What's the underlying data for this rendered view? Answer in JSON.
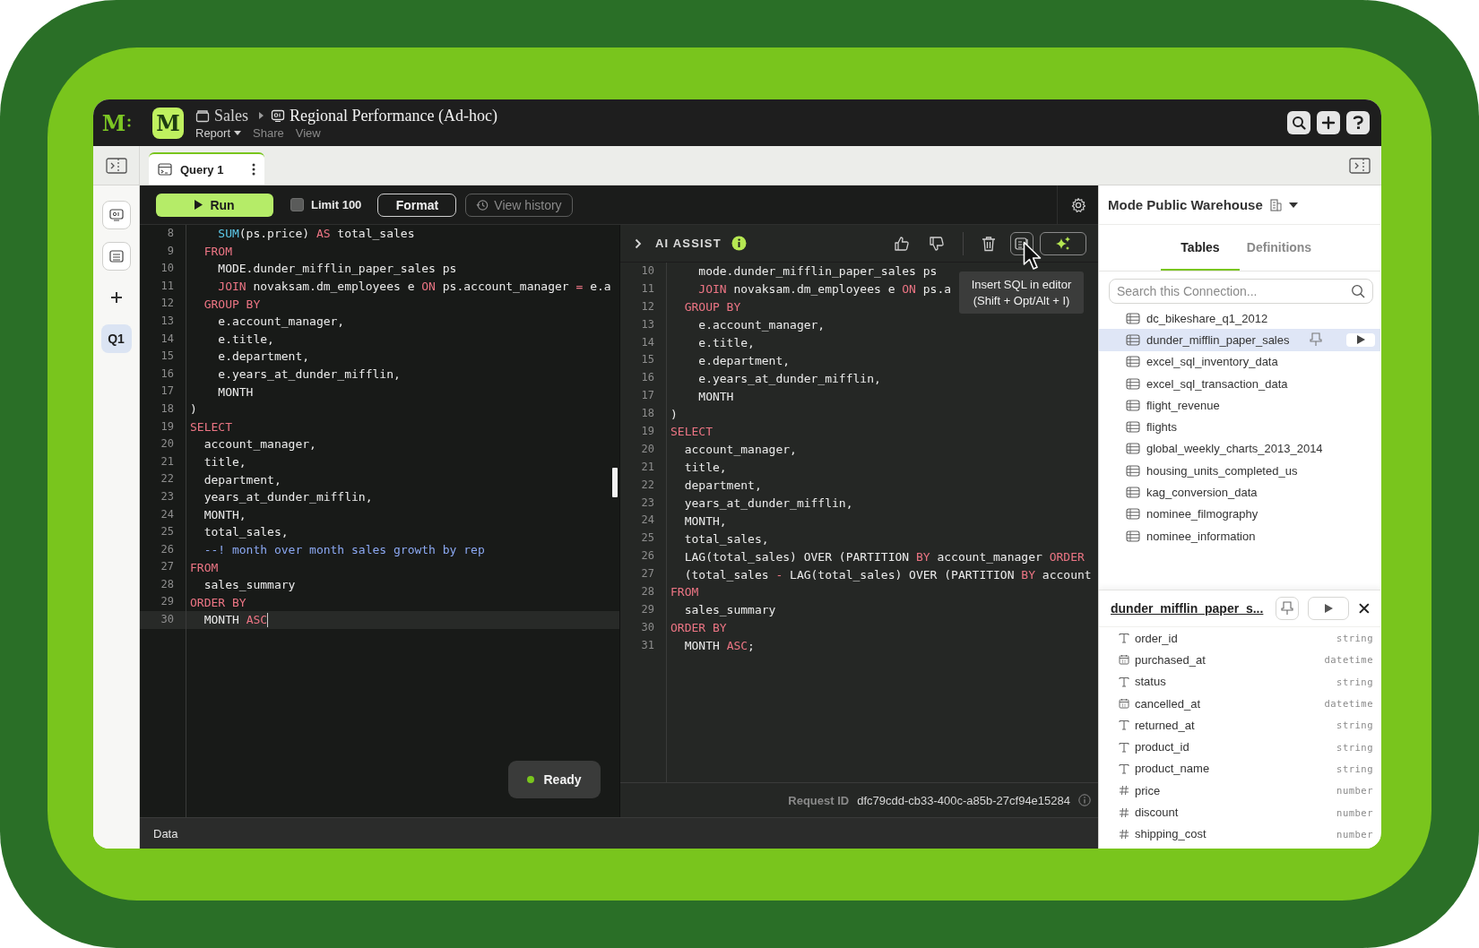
{
  "app": {
    "logo": "M",
    "workspace_logo": "M"
  },
  "breadcrumb": [
    {
      "label": "Sales",
      "kind": "folder"
    },
    {
      "label": "Regional Performance (Ad-hoc)",
      "kind": "report"
    }
  ],
  "report_menu": [
    {
      "label": "Report",
      "kind": "dropdown",
      "disabled": false
    },
    {
      "label": "Share",
      "kind": "link",
      "disabled": true
    },
    {
      "label": "View",
      "kind": "link",
      "disabled": true
    }
  ],
  "rail": {
    "badge": "Q1"
  },
  "tabs": [
    {
      "label": "Query 1",
      "selected": true
    }
  ],
  "toolbar": {
    "run": "Run",
    "limit": {
      "label": "Limit 100",
      "checked": false
    },
    "format": "Format",
    "history": {
      "label": "View history",
      "disabled": true
    }
  },
  "editor": {
    "lines": [
      {
        "number": "8",
        "current": false,
        "tokens": [
          {
            "text": "    SUM",
            "kind": "fn"
          },
          {
            "text": "(ps.price) ",
            "kind": "p"
          },
          {
            "text": "AS",
            "kind": "kw"
          },
          {
            "text": " total_sales",
            "kind": "p"
          }
        ]
      },
      {
        "number": "9",
        "current": false,
        "tokens": [
          {
            "text": "  FROM",
            "kind": "kw"
          }
        ]
      },
      {
        "number": "10",
        "current": false,
        "tokens": [
          {
            "text": "    MODE.dunder_mifflin_paper_sales ps",
            "kind": "p"
          }
        ]
      },
      {
        "number": "11",
        "current": false,
        "tokens": [
          {
            "text": "    JOIN",
            "kind": "kw"
          },
          {
            "text": " novaksam.dm_employees e ",
            "kind": "p"
          },
          {
            "text": "ON",
            "kind": "kw"
          },
          {
            "text": " ps.account_manager ",
            "kind": "p"
          },
          {
            "text": "=",
            "kind": "kw"
          },
          {
            "text": " e.a",
            "kind": "p"
          }
        ]
      },
      {
        "number": "12",
        "current": false,
        "tokens": [
          {
            "text": "  GROUP BY",
            "kind": "kw"
          }
        ]
      },
      {
        "number": "13",
        "current": false,
        "tokens": [
          {
            "text": "    e.account_manager,",
            "kind": "p"
          }
        ]
      },
      {
        "number": "14",
        "current": false,
        "tokens": [
          {
            "text": "    e.title,",
            "kind": "p"
          }
        ]
      },
      {
        "number": "15",
        "current": false,
        "tokens": [
          {
            "text": "    e.department,",
            "kind": "p"
          }
        ]
      },
      {
        "number": "16",
        "current": false,
        "tokens": [
          {
            "text": "    e.years_at_dunder_mifflin,",
            "kind": "p"
          }
        ]
      },
      {
        "number": "17",
        "current": false,
        "tokens": [
          {
            "text": "    MONTH",
            "kind": "p"
          }
        ]
      },
      {
        "number": "18",
        "current": false,
        "tokens": [
          {
            "text": ")",
            "kind": "p"
          }
        ]
      },
      {
        "number": "19",
        "current": false,
        "tokens": [
          {
            "text": "SELECT",
            "kind": "kw"
          }
        ]
      },
      {
        "number": "20",
        "current": false,
        "tokens": [
          {
            "text": "  account_manager,",
            "kind": "p"
          }
        ]
      },
      {
        "number": "21",
        "current": false,
        "tokens": [
          {
            "text": "  title,",
            "kind": "p"
          }
        ]
      },
      {
        "number": "22",
        "current": false,
        "tokens": [
          {
            "text": "  department,",
            "kind": "p"
          }
        ]
      },
      {
        "number": "23",
        "current": false,
        "tokens": [
          {
            "text": "  years_at_dunder_mifflin,",
            "kind": "p"
          }
        ]
      },
      {
        "number": "24",
        "current": false,
        "tokens": [
          {
            "text": "  MONTH,",
            "kind": "p"
          }
        ]
      },
      {
        "number": "25",
        "current": false,
        "tokens": [
          {
            "text": "  total_sales,",
            "kind": "p"
          }
        ]
      },
      {
        "number": "26",
        "current": false,
        "tokens": [
          {
            "text": "  --! month over month sales growth by rep",
            "kind": "cmt"
          }
        ]
      },
      {
        "number": "27",
        "current": false,
        "tokens": [
          {
            "text": "FROM",
            "kind": "kw"
          }
        ]
      },
      {
        "number": "28",
        "current": false,
        "tokens": [
          {
            "text": "  sales_summary",
            "kind": "p"
          }
        ]
      },
      {
        "number": "29",
        "current": false,
        "tokens": [
          {
            "text": "ORDER BY",
            "kind": "kw"
          }
        ]
      },
      {
        "number": "30",
        "current": true,
        "tokens": [
          {
            "text": "  MONTH ",
            "kind": "p"
          },
          {
            "text": "ASC",
            "kind": "kw"
          }
        ]
      }
    ],
    "status": "Ready"
  },
  "ai_assist": {
    "title": "AI ASSIST",
    "tooltip": {
      "title": "Insert SQL in editor",
      "shortcut": "(Shift + Opt/Alt + I)"
    },
    "lines": [
      {
        "number": "10",
        "tokens": [
          {
            "text": "    mode.dunder_mifflin_paper_sales ps",
            "kind": "p"
          }
        ]
      },
      {
        "number": "11",
        "tokens": [
          {
            "text": "    JOIN",
            "kind": "kw"
          },
          {
            "text": " novaksam.dm_employees e ",
            "kind": "p"
          },
          {
            "text": "ON",
            "kind": "kw"
          },
          {
            "text": " ps.a",
            "kind": "p"
          }
        ]
      },
      {
        "number": "12",
        "tokens": [
          {
            "text": "  GROUP BY",
            "kind": "kw"
          }
        ]
      },
      {
        "number": "13",
        "tokens": [
          {
            "text": "    e.account_manager,",
            "kind": "p"
          }
        ]
      },
      {
        "number": "14",
        "tokens": [
          {
            "text": "    e.title,",
            "kind": "p"
          }
        ]
      },
      {
        "number": "15",
        "tokens": [
          {
            "text": "    e.department,",
            "kind": "p"
          }
        ]
      },
      {
        "number": "16",
        "tokens": [
          {
            "text": "    e.years_at_dunder_mifflin,",
            "kind": "p"
          }
        ]
      },
      {
        "number": "17",
        "tokens": [
          {
            "text": "    MONTH",
            "kind": "p"
          }
        ]
      },
      {
        "number": "18",
        "tokens": [
          {
            "text": ")",
            "kind": "p"
          }
        ]
      },
      {
        "number": "19",
        "tokens": [
          {
            "text": "SELECT",
            "kind": "kw"
          }
        ]
      },
      {
        "number": "20",
        "tokens": [
          {
            "text": "  account_manager,",
            "kind": "p"
          }
        ]
      },
      {
        "number": "21",
        "tokens": [
          {
            "text": "  title,",
            "kind": "p"
          }
        ]
      },
      {
        "number": "22",
        "tokens": [
          {
            "text": "  department,",
            "kind": "p"
          }
        ]
      },
      {
        "number": "23",
        "tokens": [
          {
            "text": "  years_at_dunder_mifflin,",
            "kind": "p"
          }
        ]
      },
      {
        "number": "24",
        "tokens": [
          {
            "text": "  MONTH,",
            "kind": "p"
          }
        ]
      },
      {
        "number": "25",
        "tokens": [
          {
            "text": "  total_sales,",
            "kind": "p"
          }
        ]
      },
      {
        "number": "26",
        "tokens": [
          {
            "text": "  LAG(total_sales) OVER (PARTITION ",
            "kind": "p"
          },
          {
            "text": "BY",
            "kind": "kw"
          },
          {
            "text": " account_manager ",
            "kind": "p"
          },
          {
            "text": "ORDER",
            "kind": "kw"
          }
        ]
      },
      {
        "number": "27",
        "tokens": [
          {
            "text": "  (total_sales ",
            "kind": "p"
          },
          {
            "text": "-",
            "kind": "kw"
          },
          {
            "text": " LAG(total_sales) OVER (PARTITION ",
            "kind": "p"
          },
          {
            "text": "BY",
            "kind": "kw"
          },
          {
            "text": " account",
            "kind": "p"
          }
        ]
      },
      {
        "number": "28",
        "tokens": [
          {
            "text": "FROM",
            "kind": "kw"
          }
        ]
      },
      {
        "number": "29",
        "tokens": [
          {
            "text": "  sales_summary",
            "kind": "p"
          }
        ]
      },
      {
        "number": "30",
        "tokens": [
          {
            "text": "ORDER BY",
            "kind": "kw"
          }
        ]
      },
      {
        "number": "31",
        "tokens": [
          {
            "text": "  MONTH ",
            "kind": "p"
          },
          {
            "text": "ASC",
            "kind": "kw"
          },
          {
            "text": ";",
            "kind": "p"
          }
        ]
      }
    ],
    "request_label": "Request ID",
    "request_id": "dfc79cdd-cb33-400c-a85b-27cf94e15284"
  },
  "data_bar": "Data",
  "sidebar": {
    "connection": "Mode Public Warehouse",
    "tabs": [
      {
        "label": "Tables",
        "selected": true
      },
      {
        "label": "Definitions",
        "selected": false
      }
    ],
    "search": {
      "placeholder": "Search this Connection..."
    },
    "tables": [
      {
        "name": "dc_bikeshare_q1_2012",
        "selected": false
      },
      {
        "name": "dunder_mifflin_paper_sales",
        "selected": true
      },
      {
        "name": "excel_sql_inventory_data",
        "selected": false
      },
      {
        "name": "excel_sql_transaction_data",
        "selected": false
      },
      {
        "name": "flight_revenue",
        "selected": false
      },
      {
        "name": "flights",
        "selected": false
      },
      {
        "name": "global_weekly_charts_2013_2014",
        "selected": false
      },
      {
        "name": "housing_units_completed_us",
        "selected": false
      },
      {
        "name": "kag_conversion_data",
        "selected": false
      },
      {
        "name": "nominee_filmography",
        "selected": false
      },
      {
        "name": "nominee_information",
        "selected": false
      }
    ],
    "detail": {
      "title": "dunder_mifflin_paper_s...",
      "columns": [
        {
          "name": "order_id",
          "type": "string",
          "kind": "text"
        },
        {
          "name": "purchased_at",
          "type": "datetime",
          "kind": "date"
        },
        {
          "name": "status",
          "type": "string",
          "kind": "text"
        },
        {
          "name": "cancelled_at",
          "type": "datetime",
          "kind": "date"
        },
        {
          "name": "returned_at",
          "type": "string",
          "kind": "text"
        },
        {
          "name": "product_id",
          "type": "string",
          "kind": "text"
        },
        {
          "name": "product_name",
          "type": "string",
          "kind": "text"
        },
        {
          "name": "price",
          "type": "number",
          "kind": "number"
        },
        {
          "name": "discount",
          "type": "number",
          "kind": "number"
        },
        {
          "name": "shipping_cost",
          "type": "number",
          "kind": "number"
        }
      ]
    }
  }
}
